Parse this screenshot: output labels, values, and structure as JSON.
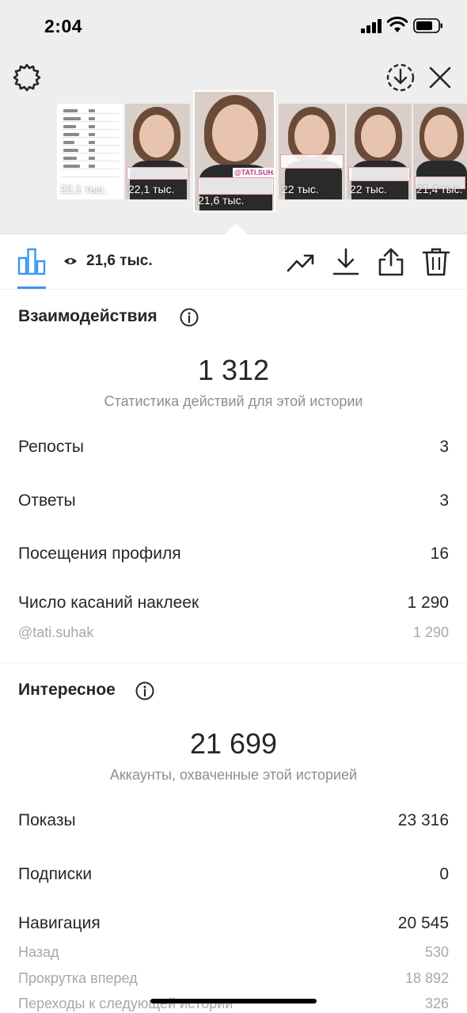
{
  "status_bar": {
    "time": "2:04"
  },
  "stories": [
    {
      "views": "22,1 тыс."
    },
    {
      "views": "22,1 тыс."
    },
    {
      "views": "21,6 тыс.",
      "sticker": "@TATI.SUHAK"
    },
    {
      "views": "22 тыс."
    },
    {
      "views": "22 тыс."
    },
    {
      "views": "21,4 тыс."
    }
  ],
  "toolbar": {
    "views": "21,6 тыс."
  },
  "interactions": {
    "title": "Взаимодействия",
    "total": "1 312",
    "subtitle": "Статистика действий для этой истории",
    "rows": [
      {
        "label": "Репосты",
        "value": "3"
      },
      {
        "label": "Ответы",
        "value": "3"
      },
      {
        "label": "Посещения профиля",
        "value": "16"
      },
      {
        "label": "Число касаний наклеек",
        "value": "1 290"
      }
    ],
    "sticker_row": {
      "label": "@tati.suhak",
      "value": "1 290"
    }
  },
  "discovery": {
    "title": "Интересное",
    "total": "21 699",
    "subtitle": "Аккаунты, охваченные этой историей",
    "rows": [
      {
        "label": "Показы",
        "value": "23 316"
      },
      {
        "label": "Подписки",
        "value": "0"
      },
      {
        "label": "Навигация",
        "value": "20 545"
      }
    ],
    "nav_rows": [
      {
        "label": "Назад",
        "value": "530"
      },
      {
        "label": "Прокрутка вперед",
        "value": "18 892"
      },
      {
        "label": "Переходы к следующей истории",
        "value": "326"
      }
    ]
  },
  "colors": {
    "accent": "#3897f0",
    "text": "#262626",
    "muted": "#8e8e8e"
  }
}
